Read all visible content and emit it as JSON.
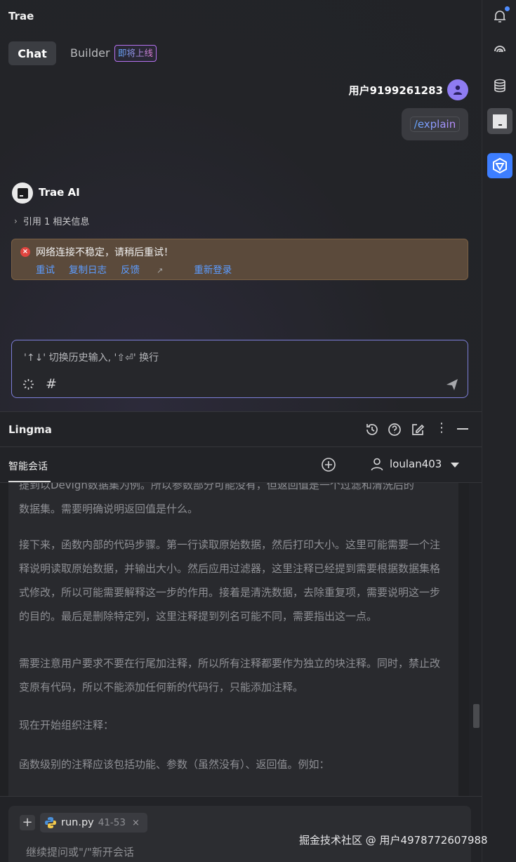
{
  "trae": {
    "title": "Trae",
    "tabs": {
      "chat": "Chat",
      "builder": "Builder",
      "builder_badge": "即将上线"
    },
    "user_message": {
      "username": "用户9199261283",
      "command": "/explain"
    },
    "ai": {
      "name": "Trae AI",
      "reference": "引用 1 相关信息",
      "error": {
        "message": "网络连接不稳定，请稍后重试！",
        "actions": [
          "重试",
          "复制日志",
          "反馈",
          "重新登录"
        ]
      }
    },
    "input": {
      "placeholder": "'↑↓' 切换历史输入, '⇧⏎' 换行"
    }
  },
  "activity_bar": {
    "icons": [
      "bell-icon",
      "trae-swirl-icon",
      "database-icon",
      "trae-panel-icon",
      "lingma-icon"
    ]
  },
  "lingma": {
    "title": "Lingma",
    "tab": "智能会话",
    "username": "loulan403",
    "paragraphs": [
      "提到以Devign数据集为例。所以参数部分可能没有，但返回值是一个过滤和清洗后的",
      "数据集。需要明确说明返回值是什么。",
      "接下来，函数内部的代码步骤。第一行读取原始数据，然后打印大小。这里可能需要一个注释说明读取原始数据，并输出大小。然后应用过滤器，这里注释已经提到需要根据数据集格式修改，所以可能需要解释这一步的作用。接着是清洗数据，去除重复项，需要说明这一步的目的。最后是删除特定列，这里注释提到列名可能不同，需要指出这一点。",
      "需要注意用户要求不要在行尾加注释，所以所有注释都要作为独立的块注释。同时，禁止改变原有代码，所以不能添加任何新的代码行，只能添加注释。",
      "现在开始组织注释：",
      "函数级别的注释应该包括功能、参数（虽然没有）、返回值。例如："
    ],
    "context_file": {
      "name": "run.py",
      "range": "41-53",
      "close": "×"
    },
    "input_placeholder": "继续提问或\"/\"新开会话"
  },
  "watermark": "掘金技术社区 @ 用户4978772607988",
  "colors": {
    "accent_blue": "#3d7eff",
    "link": "#5c9cff",
    "error": "#e0453f",
    "avatar_purple": "#8f7cf2"
  }
}
